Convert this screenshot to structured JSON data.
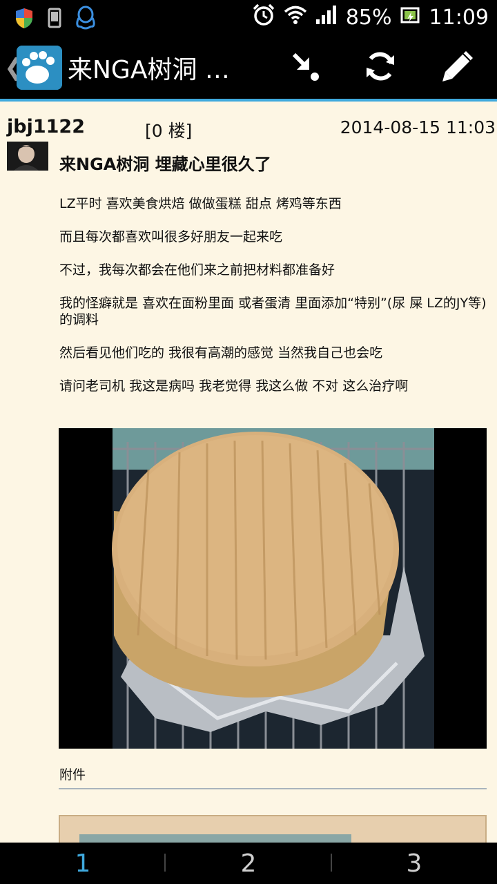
{
  "status_bar": {
    "battery": "85%",
    "time": "11:09",
    "icons": [
      "shield-icon",
      "phone-icon",
      "qq-penguin-icon",
      "alarm-icon",
      "wifi-icon",
      "signal-icon",
      "battery-icon"
    ]
  },
  "action_bar": {
    "title": "来NGA树洞 埋...",
    "actions": [
      "jump-to-floor-icon",
      "refresh-icon",
      "edit-icon"
    ]
  },
  "post": {
    "username": "jbj1122",
    "floor": "[0 楼]",
    "time": "2014-08-15 11:03",
    "title": "来NGA树洞 埋藏心里很久了",
    "paragraphs": [
      "LZ平时 喜欢美食烘焙 做做蛋糕 甜点 烤鸡等东西",
      "而且每次都喜欢叫很多好朋友一起来吃",
      "不过，我每次都会在他们来之前把材料都准备好",
      "我的怪癖就是 喜欢在面粉里面 或者蛋清 里面添加“特别”(尿 屎 LZ的JY等) 的调料",
      "然后看见他们吃的 我很有高潮的感觉 当然我自己也会吃",
      "请问老司机 我这是病吗 我老觉得 我这么做 不对 这么治疗啊"
    ],
    "attachment_label": "附件"
  },
  "pager": {
    "pages": [
      "1",
      "2",
      "3"
    ],
    "active": "1"
  },
  "colors": {
    "background": "#fdf6e4",
    "accent": "#3fa9dd",
    "bar": "#000000"
  }
}
